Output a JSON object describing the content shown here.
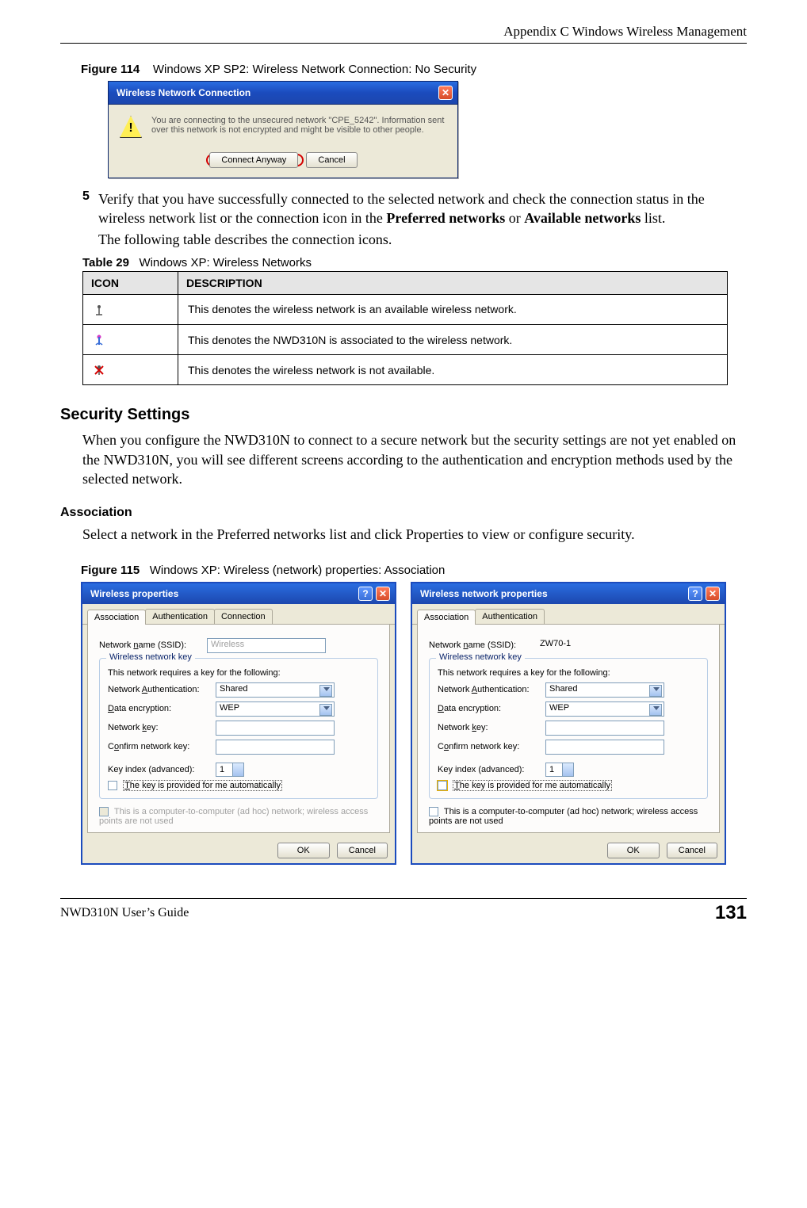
{
  "header": {
    "appendix": "Appendix C Windows Wireless Management"
  },
  "fig114": {
    "label": "Figure 114",
    "title": "Windows XP SP2: Wireless Network Connection: No Security",
    "dialog": {
      "title": "Wireless Network Connection",
      "message": "You are connecting to the unsecured network \"CPE_5242\". Information sent over this network is not encrypted and might be visible to other people.",
      "btn_connect": "Connect Anyway",
      "btn_cancel": "Cancel"
    }
  },
  "step5": {
    "num": "5",
    "text_a": "Verify that you have successfully connected to the selected network and check the connection status in the wireless network list or the connection icon in the ",
    "bold_a": "Preferred networks",
    "text_b": " or ",
    "bold_b": "Available networks",
    "text_c": " list.",
    "followup": "The following table describes the connection icons."
  },
  "table29": {
    "label": "Table 29",
    "title": "Windows XP: Wireless Networks",
    "head_icon": "ICON",
    "head_desc": "DESCRIPTION",
    "rows": [
      {
        "iconname": "antenna-icon",
        "desc": "This denotes the wireless network is an available wireless network."
      },
      {
        "iconname": "associated-icon",
        "desc": "This denotes the NWD310N is associated to the wireless network."
      },
      {
        "iconname": "unavailable-icon",
        "desc": "This denotes the wireless network is not available."
      }
    ]
  },
  "sec_settings": {
    "heading": "Security Settings",
    "para": "When you configure the NWD310N to connect to a secure network but the security settings are not yet enabled on the NWD310N, you will see different screens according to the authentication and encryption methods used by the selected network."
  },
  "assoc": {
    "heading": "Association",
    "para": "Select a network in the Preferred networks list and click Properties to view or configure security."
  },
  "fig115": {
    "label": "Figure 115",
    "title": "Windows XP: Wireless (network) properties: Association"
  },
  "dlgA": {
    "title": "Wireless properties",
    "tabs": [
      "Association",
      "Authentication",
      "Connection"
    ],
    "ssid_label": "Network name (SSID):",
    "ssid_value": "Wireless",
    "legend": "Wireless network key",
    "keymsg": "This network requires a key for the following:",
    "auth_label": "Network Authentication:",
    "auth_value": "Shared",
    "enc_label": "Data encryption:",
    "enc_value": "WEP",
    "nkey_label": "Network key:",
    "ckey_label": "Confirm network key:",
    "kidx_label": "Key index (advanced):",
    "kidx_value": "1",
    "auto_label": "The key is provided for me automatically",
    "adhoc_label": "This is a computer-to-computer (ad hoc) network; wireless access points are not used",
    "ok": "OK",
    "cancel": "Cancel"
  },
  "dlgB": {
    "title": "Wireless network properties",
    "tabs": [
      "Association",
      "Authentication"
    ],
    "ssid_label": "Network name (SSID):",
    "ssid_value": "ZW70-1",
    "legend": "Wireless network key",
    "keymsg": "This network requires a key for the following:",
    "auth_label": "Network Authentication:",
    "auth_value": "Shared",
    "enc_label": "Data encryption:",
    "enc_value": "WEP",
    "nkey_label": "Network key:",
    "ckey_label": "Confirm network key:",
    "kidx_label": "Key index (advanced):",
    "kidx_value": "1",
    "auto_label": "The key is provided for me automatically",
    "adhoc_label": "This is a computer-to-computer (ad hoc) network; wireless access points are not used",
    "ok": "OK",
    "cancel": "Cancel"
  },
  "footer": {
    "guide": "NWD310N User’s Guide",
    "page": "131"
  }
}
